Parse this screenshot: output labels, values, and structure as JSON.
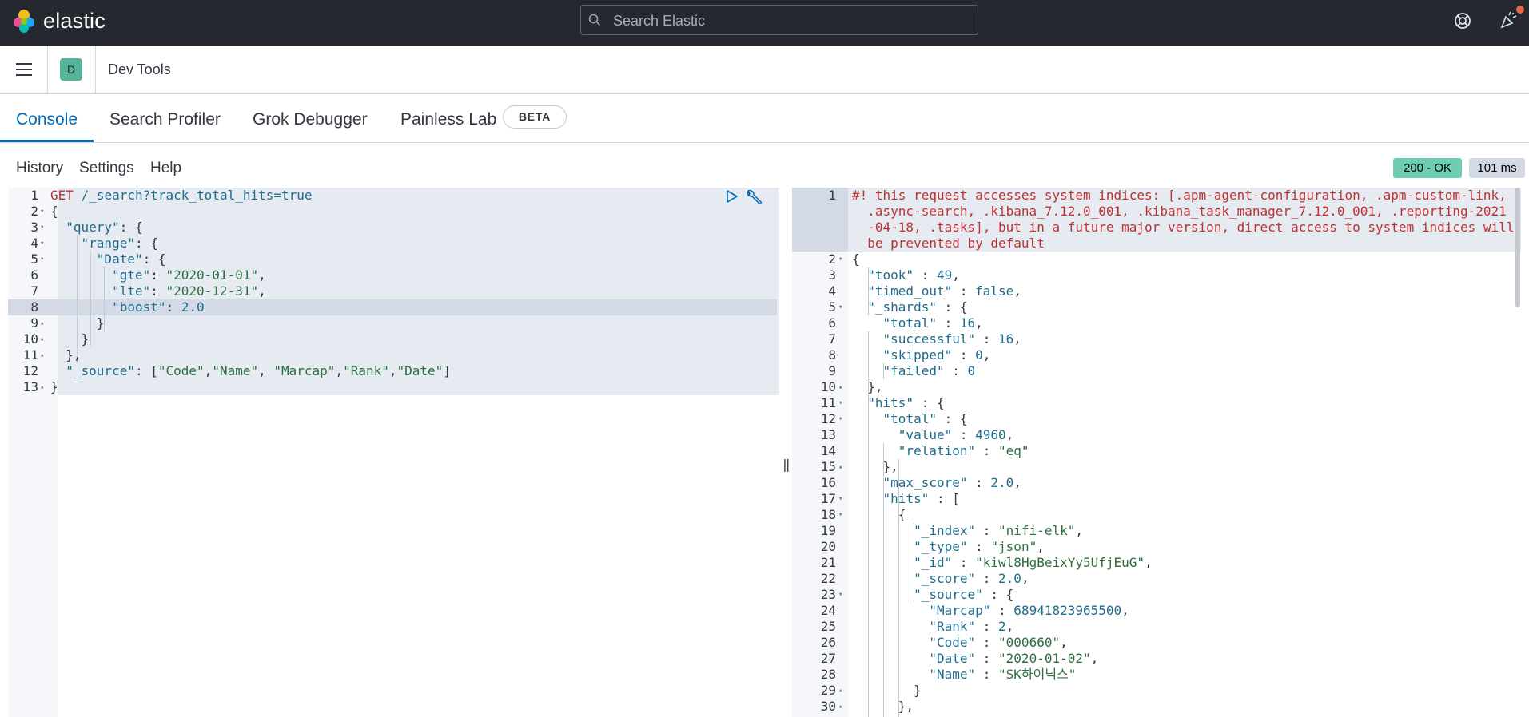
{
  "topbar": {
    "brand": "elastic",
    "search_placeholder": "Search Elastic"
  },
  "header": {
    "space_initial": "D",
    "breadcrumb": "Dev Tools"
  },
  "tabs": [
    {
      "label": "Console",
      "active": true
    },
    {
      "label": "Search Profiler",
      "active": false
    },
    {
      "label": "Grok Debugger",
      "active": false
    },
    {
      "label": "Painless Lab",
      "active": false
    }
  ],
  "beta_badge": "BETA",
  "toolbar": {
    "history": "History",
    "settings": "Settings",
    "help": "Help"
  },
  "response_status": "200 - OK",
  "response_time": "101 ms",
  "colors": {
    "accent": "#006bb8",
    "topbar_bg": "#25282f",
    "status_ok": "#6dccb1",
    "space_avatar": "#54b399"
  },
  "request_lines": [
    {
      "n": "1",
      "fold": "",
      "parts": [
        [
          "k",
          "GET"
        ],
        [
          "p",
          " "
        ],
        [
          "u",
          "/_search?track_total_hits=true"
        ]
      ]
    },
    {
      "n": "2",
      "fold": "▾",
      "parts": [
        [
          "p",
          "{"
        ]
      ]
    },
    {
      "n": "3",
      "fold": "▾",
      "parts": [
        [
          "p",
          "  "
        ],
        [
          "key",
          "\"query\""
        ],
        [
          "p",
          ": {"
        ]
      ]
    },
    {
      "n": "4",
      "fold": "▾",
      "parts": [
        [
          "p",
          "    "
        ],
        [
          "key",
          "\"range\""
        ],
        [
          "p",
          ": {"
        ]
      ]
    },
    {
      "n": "5",
      "fold": "▾",
      "parts": [
        [
          "p",
          "      "
        ],
        [
          "key",
          "\"Date\""
        ],
        [
          "p",
          ": {"
        ]
      ]
    },
    {
      "n": "6",
      "fold": "",
      "parts": [
        [
          "p",
          "        "
        ],
        [
          "key",
          "\"gte\""
        ],
        [
          "p",
          ": "
        ],
        [
          "str",
          "\"2020-01-01\""
        ],
        [
          "p",
          ","
        ]
      ]
    },
    {
      "n": "7",
      "fold": "",
      "parts": [
        [
          "p",
          "        "
        ],
        [
          "key",
          "\"lte\""
        ],
        [
          "p",
          ": "
        ],
        [
          "str",
          "\"2020-12-31\""
        ],
        [
          "p",
          ","
        ]
      ]
    },
    {
      "n": "8",
      "fold": "",
      "parts": [
        [
          "p",
          "        "
        ],
        [
          "key",
          "\"boost\""
        ],
        [
          "p",
          ": "
        ],
        [
          "num",
          "2.0"
        ]
      ]
    },
    {
      "n": "9",
      "fold": "▴",
      "parts": [
        [
          "p",
          "      }"
        ]
      ]
    },
    {
      "n": "10",
      "fold": "▴",
      "parts": [
        [
          "p",
          "    }"
        ]
      ]
    },
    {
      "n": "11",
      "fold": "▴",
      "parts": [
        [
          "p",
          "  },"
        ]
      ]
    },
    {
      "n": "12",
      "fold": "",
      "parts": [
        [
          "p",
          "  "
        ],
        [
          "key",
          "\"_source\""
        ],
        [
          "p",
          ": ["
        ],
        [
          "str",
          "\"Code\""
        ],
        [
          "p",
          ","
        ],
        [
          "str",
          "\"Name\""
        ],
        [
          "p",
          ", "
        ],
        [
          "str",
          "\"Marcap\""
        ],
        [
          "p",
          ","
        ],
        [
          "str",
          "\"Rank\""
        ],
        [
          "p",
          ","
        ],
        [
          "str",
          "\"Date\""
        ],
        [
          "p",
          "]"
        ]
      ]
    },
    {
      "n": "13",
      "fold": "▴",
      "parts": [
        [
          "p",
          "}"
        ]
      ]
    }
  ],
  "response_warning": [
    "#! this request accesses system indices: [.apm-agent-configuration, .apm-custom-link,",
    "  .async-search, .kibana_7.12.0_001, .kibana_task_manager_7.12.0_001, .reporting-2021",
    "  -04-18, .tasks], but in a future major version, direct access to system indices will",
    "  be prevented by default"
  ],
  "response_lines": [
    {
      "n": "2",
      "fold": "▾",
      "parts": [
        [
          "p",
          "{"
        ]
      ]
    },
    {
      "n": "3",
      "fold": "",
      "parts": [
        [
          "p",
          "  "
        ],
        [
          "key",
          "\"took\""
        ],
        [
          "p",
          " : "
        ],
        [
          "num",
          "49"
        ],
        [
          "p",
          ","
        ]
      ]
    },
    {
      "n": "4",
      "fold": "",
      "parts": [
        [
          "p",
          "  "
        ],
        [
          "key",
          "\"timed_out\""
        ],
        [
          "p",
          " : "
        ],
        [
          "num",
          "false"
        ],
        [
          "p",
          ","
        ]
      ]
    },
    {
      "n": "5",
      "fold": "▾",
      "parts": [
        [
          "p",
          "  "
        ],
        [
          "key",
          "\"_shards\""
        ],
        [
          "p",
          " : {"
        ]
      ]
    },
    {
      "n": "6",
      "fold": "",
      "parts": [
        [
          "p",
          "    "
        ],
        [
          "key",
          "\"total\""
        ],
        [
          "p",
          " : "
        ],
        [
          "num",
          "16"
        ],
        [
          "p",
          ","
        ]
      ]
    },
    {
      "n": "7",
      "fold": "",
      "parts": [
        [
          "p",
          "    "
        ],
        [
          "key",
          "\"successful\""
        ],
        [
          "p",
          " : "
        ],
        [
          "num",
          "16"
        ],
        [
          "p",
          ","
        ]
      ]
    },
    {
      "n": "8",
      "fold": "",
      "parts": [
        [
          "p",
          "    "
        ],
        [
          "key",
          "\"skipped\""
        ],
        [
          "p",
          " : "
        ],
        [
          "num",
          "0"
        ],
        [
          "p",
          ","
        ]
      ]
    },
    {
      "n": "9",
      "fold": "",
      "parts": [
        [
          "p",
          "    "
        ],
        [
          "key",
          "\"failed\""
        ],
        [
          "p",
          " : "
        ],
        [
          "num",
          "0"
        ]
      ]
    },
    {
      "n": "10",
      "fold": "▴",
      "parts": [
        [
          "p",
          "  },"
        ]
      ]
    },
    {
      "n": "11",
      "fold": "▾",
      "parts": [
        [
          "p",
          "  "
        ],
        [
          "key",
          "\"hits\""
        ],
        [
          "p",
          " : {"
        ]
      ]
    },
    {
      "n": "12",
      "fold": "▾",
      "parts": [
        [
          "p",
          "    "
        ],
        [
          "key",
          "\"total\""
        ],
        [
          "p",
          " : {"
        ]
      ]
    },
    {
      "n": "13",
      "fold": "",
      "parts": [
        [
          "p",
          "      "
        ],
        [
          "key",
          "\"value\""
        ],
        [
          "p",
          " : "
        ],
        [
          "num",
          "4960"
        ],
        [
          "p",
          ","
        ]
      ]
    },
    {
      "n": "14",
      "fold": "",
      "parts": [
        [
          "p",
          "      "
        ],
        [
          "key",
          "\"relation\""
        ],
        [
          "p",
          " : "
        ],
        [
          "str",
          "\"eq\""
        ]
      ]
    },
    {
      "n": "15",
      "fold": "▴",
      "parts": [
        [
          "p",
          "    },"
        ]
      ]
    },
    {
      "n": "16",
      "fold": "",
      "parts": [
        [
          "p",
          "    "
        ],
        [
          "key",
          "\"max_score\""
        ],
        [
          "p",
          " : "
        ],
        [
          "num",
          "2.0"
        ],
        [
          "p",
          ","
        ]
      ]
    },
    {
      "n": "17",
      "fold": "▾",
      "parts": [
        [
          "p",
          "    "
        ],
        [
          "key",
          "\"hits\""
        ],
        [
          "p",
          " : ["
        ]
      ]
    },
    {
      "n": "18",
      "fold": "▾",
      "parts": [
        [
          "p",
          "      {"
        ]
      ]
    },
    {
      "n": "19",
      "fold": "",
      "parts": [
        [
          "p",
          "        "
        ],
        [
          "key",
          "\"_index\""
        ],
        [
          "p",
          " : "
        ],
        [
          "str",
          "\"nifi-elk\""
        ],
        [
          "p",
          ","
        ]
      ]
    },
    {
      "n": "20",
      "fold": "",
      "parts": [
        [
          "p",
          "        "
        ],
        [
          "key",
          "\"_type\""
        ],
        [
          "p",
          " : "
        ],
        [
          "str",
          "\"json\""
        ],
        [
          "p",
          ","
        ]
      ]
    },
    {
      "n": "21",
      "fold": "",
      "parts": [
        [
          "p",
          "        "
        ],
        [
          "key",
          "\"_id\""
        ],
        [
          "p",
          " : "
        ],
        [
          "str",
          "\"kiwl8HgBeixYy5UfjEuG\""
        ],
        [
          "p",
          ","
        ]
      ]
    },
    {
      "n": "22",
      "fold": "",
      "parts": [
        [
          "p",
          "        "
        ],
        [
          "key",
          "\"_score\""
        ],
        [
          "p",
          " : "
        ],
        [
          "num",
          "2.0"
        ],
        [
          "p",
          ","
        ]
      ]
    },
    {
      "n": "23",
      "fold": "▾",
      "parts": [
        [
          "p",
          "        "
        ],
        [
          "key",
          "\"_source\""
        ],
        [
          "p",
          " : {"
        ]
      ]
    },
    {
      "n": "24",
      "fold": "",
      "parts": [
        [
          "p",
          "          "
        ],
        [
          "key",
          "\"Marcap\""
        ],
        [
          "p",
          " : "
        ],
        [
          "num",
          "68941823965500"
        ],
        [
          "p",
          ","
        ]
      ]
    },
    {
      "n": "25",
      "fold": "",
      "parts": [
        [
          "p",
          "          "
        ],
        [
          "key",
          "\"Rank\""
        ],
        [
          "p",
          " : "
        ],
        [
          "num",
          "2"
        ],
        [
          "p",
          ","
        ]
      ]
    },
    {
      "n": "26",
      "fold": "",
      "parts": [
        [
          "p",
          "          "
        ],
        [
          "key",
          "\"Code\""
        ],
        [
          "p",
          " : "
        ],
        [
          "str",
          "\"000660\""
        ],
        [
          "p",
          ","
        ]
      ]
    },
    {
      "n": "27",
      "fold": "",
      "parts": [
        [
          "p",
          "          "
        ],
        [
          "key",
          "\"Date\""
        ],
        [
          "p",
          " : "
        ],
        [
          "str",
          "\"2020-01-02\""
        ],
        [
          "p",
          ","
        ]
      ]
    },
    {
      "n": "28",
      "fold": "",
      "parts": [
        [
          "p",
          "          "
        ],
        [
          "key",
          "\"Name\""
        ],
        [
          "p",
          " : "
        ],
        [
          "str",
          "\"SK하이닉스\""
        ]
      ]
    },
    {
      "n": "29",
      "fold": "▴",
      "parts": [
        [
          "p",
          "        }"
        ]
      ]
    },
    {
      "n": "30",
      "fold": "▴",
      "parts": [
        [
          "p",
          "      },"
        ]
      ]
    }
  ]
}
